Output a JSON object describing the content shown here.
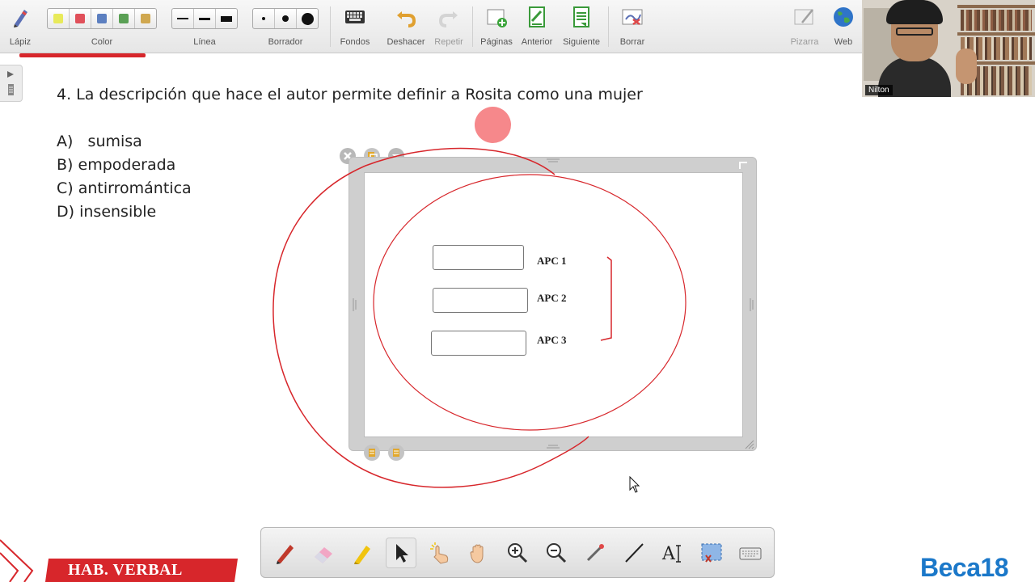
{
  "toolbar": {
    "pencil_label": "Lápiz",
    "color_label": "Color",
    "line_label": "Línea",
    "eraser_label": "Borrador",
    "backgrounds_label": "Fondos",
    "undo_label": "Deshacer",
    "redo_label": "Repetir",
    "pages_label": "Páginas",
    "previous_label": "Anterior",
    "next_label": "Siguiente",
    "clear_label": "Borrar",
    "board_label": "Pizarra",
    "web_label": "Web",
    "colors": [
      "#e8ea5a",
      "#e0505a",
      "#5c7fc0",
      "#5aa055",
      "#d0a850"
    ]
  },
  "webcam": {
    "name": "Nilton"
  },
  "slide": {
    "question": "4. La descripción que hace el autor permite definir a Rosita como una mujer",
    "options": [
      {
        "letter": "A)",
        "text": "sumisa"
      },
      {
        "letter": "B)",
        "text": "empoderada"
      },
      {
        "letter": "C)",
        "text": "antirromántica"
      },
      {
        "letter": "D)",
        "text": "insensible"
      }
    ]
  },
  "embed": {
    "labels": [
      "APC 1",
      "APC 2",
      "APC 3"
    ]
  },
  "footer": {
    "course": "HAB. VERBAL",
    "brand": "Beca18"
  },
  "colors": {
    "accent_red": "#d7262b",
    "brand_blue": "#1b78c9",
    "annotation_red": "#d7262b"
  }
}
